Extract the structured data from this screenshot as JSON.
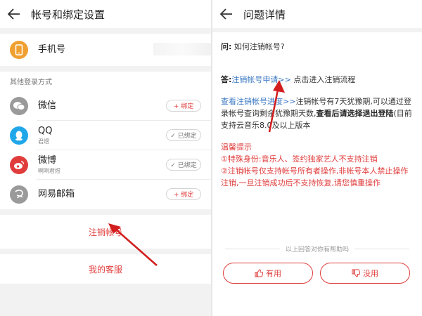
{
  "left": {
    "title": "帐号和绑定设置",
    "phone": {
      "label": "手机号"
    },
    "other_login_label": "其他登录方式",
    "items": [
      {
        "label": "微信",
        "sub": "",
        "action": "+ 绑定",
        "icon": "wechat-icon",
        "color": "#9a9a9a"
      },
      {
        "label": "QQ",
        "sub": "君煜",
        "action": "✓ 已绑定",
        "icon": "qq-icon",
        "color": "#1fa7ea"
      },
      {
        "label": "微博",
        "sub": "啊咧君煜",
        "action": "✓ 已绑定",
        "icon": "weibo-icon",
        "color": "#e03c3c"
      },
      {
        "label": "网易邮箱",
        "sub": "",
        "action": "+ 绑定",
        "icon": "netease-mail-icon",
        "color": "#9a9a9a"
      }
    ],
    "cancel_account": "注销帐号",
    "customer_service": "我的客服"
  },
  "right": {
    "title": "问题详情",
    "q_prefix": "问:",
    "q_text": "如何注销帐号?",
    "a_prefix": "答:",
    "a_link": "注销帐号申请>>",
    "a_text": "点击进入注销流程",
    "p1_link": "查看注销帐号进度>>",
    "p1_text1": "注销帐号有7天犹豫期,可以通过登录帐号查询剩余犹豫期天数,",
    "p1_bold": "查看后请选择退出登陆",
    "p1_text2": "(目前支持云音乐8.0及以上版本",
    "warn_title": "温馨提示",
    "warn1": "①特殊身份:音乐人、签约独家艺人不支持注销",
    "warn2": "②注销帐号仅支持帐号所有者操作,非帐号本人禁止操作注销,一旦注销成功后不支持恢复,请您慎重操作",
    "helpful_text": "以上回答对你有帮助吗",
    "useful": "有用",
    "useless": "没用"
  },
  "colors": {
    "accent": "#e03c3c",
    "link": "#3a78c3",
    "phone_icon": "#f0a030"
  }
}
